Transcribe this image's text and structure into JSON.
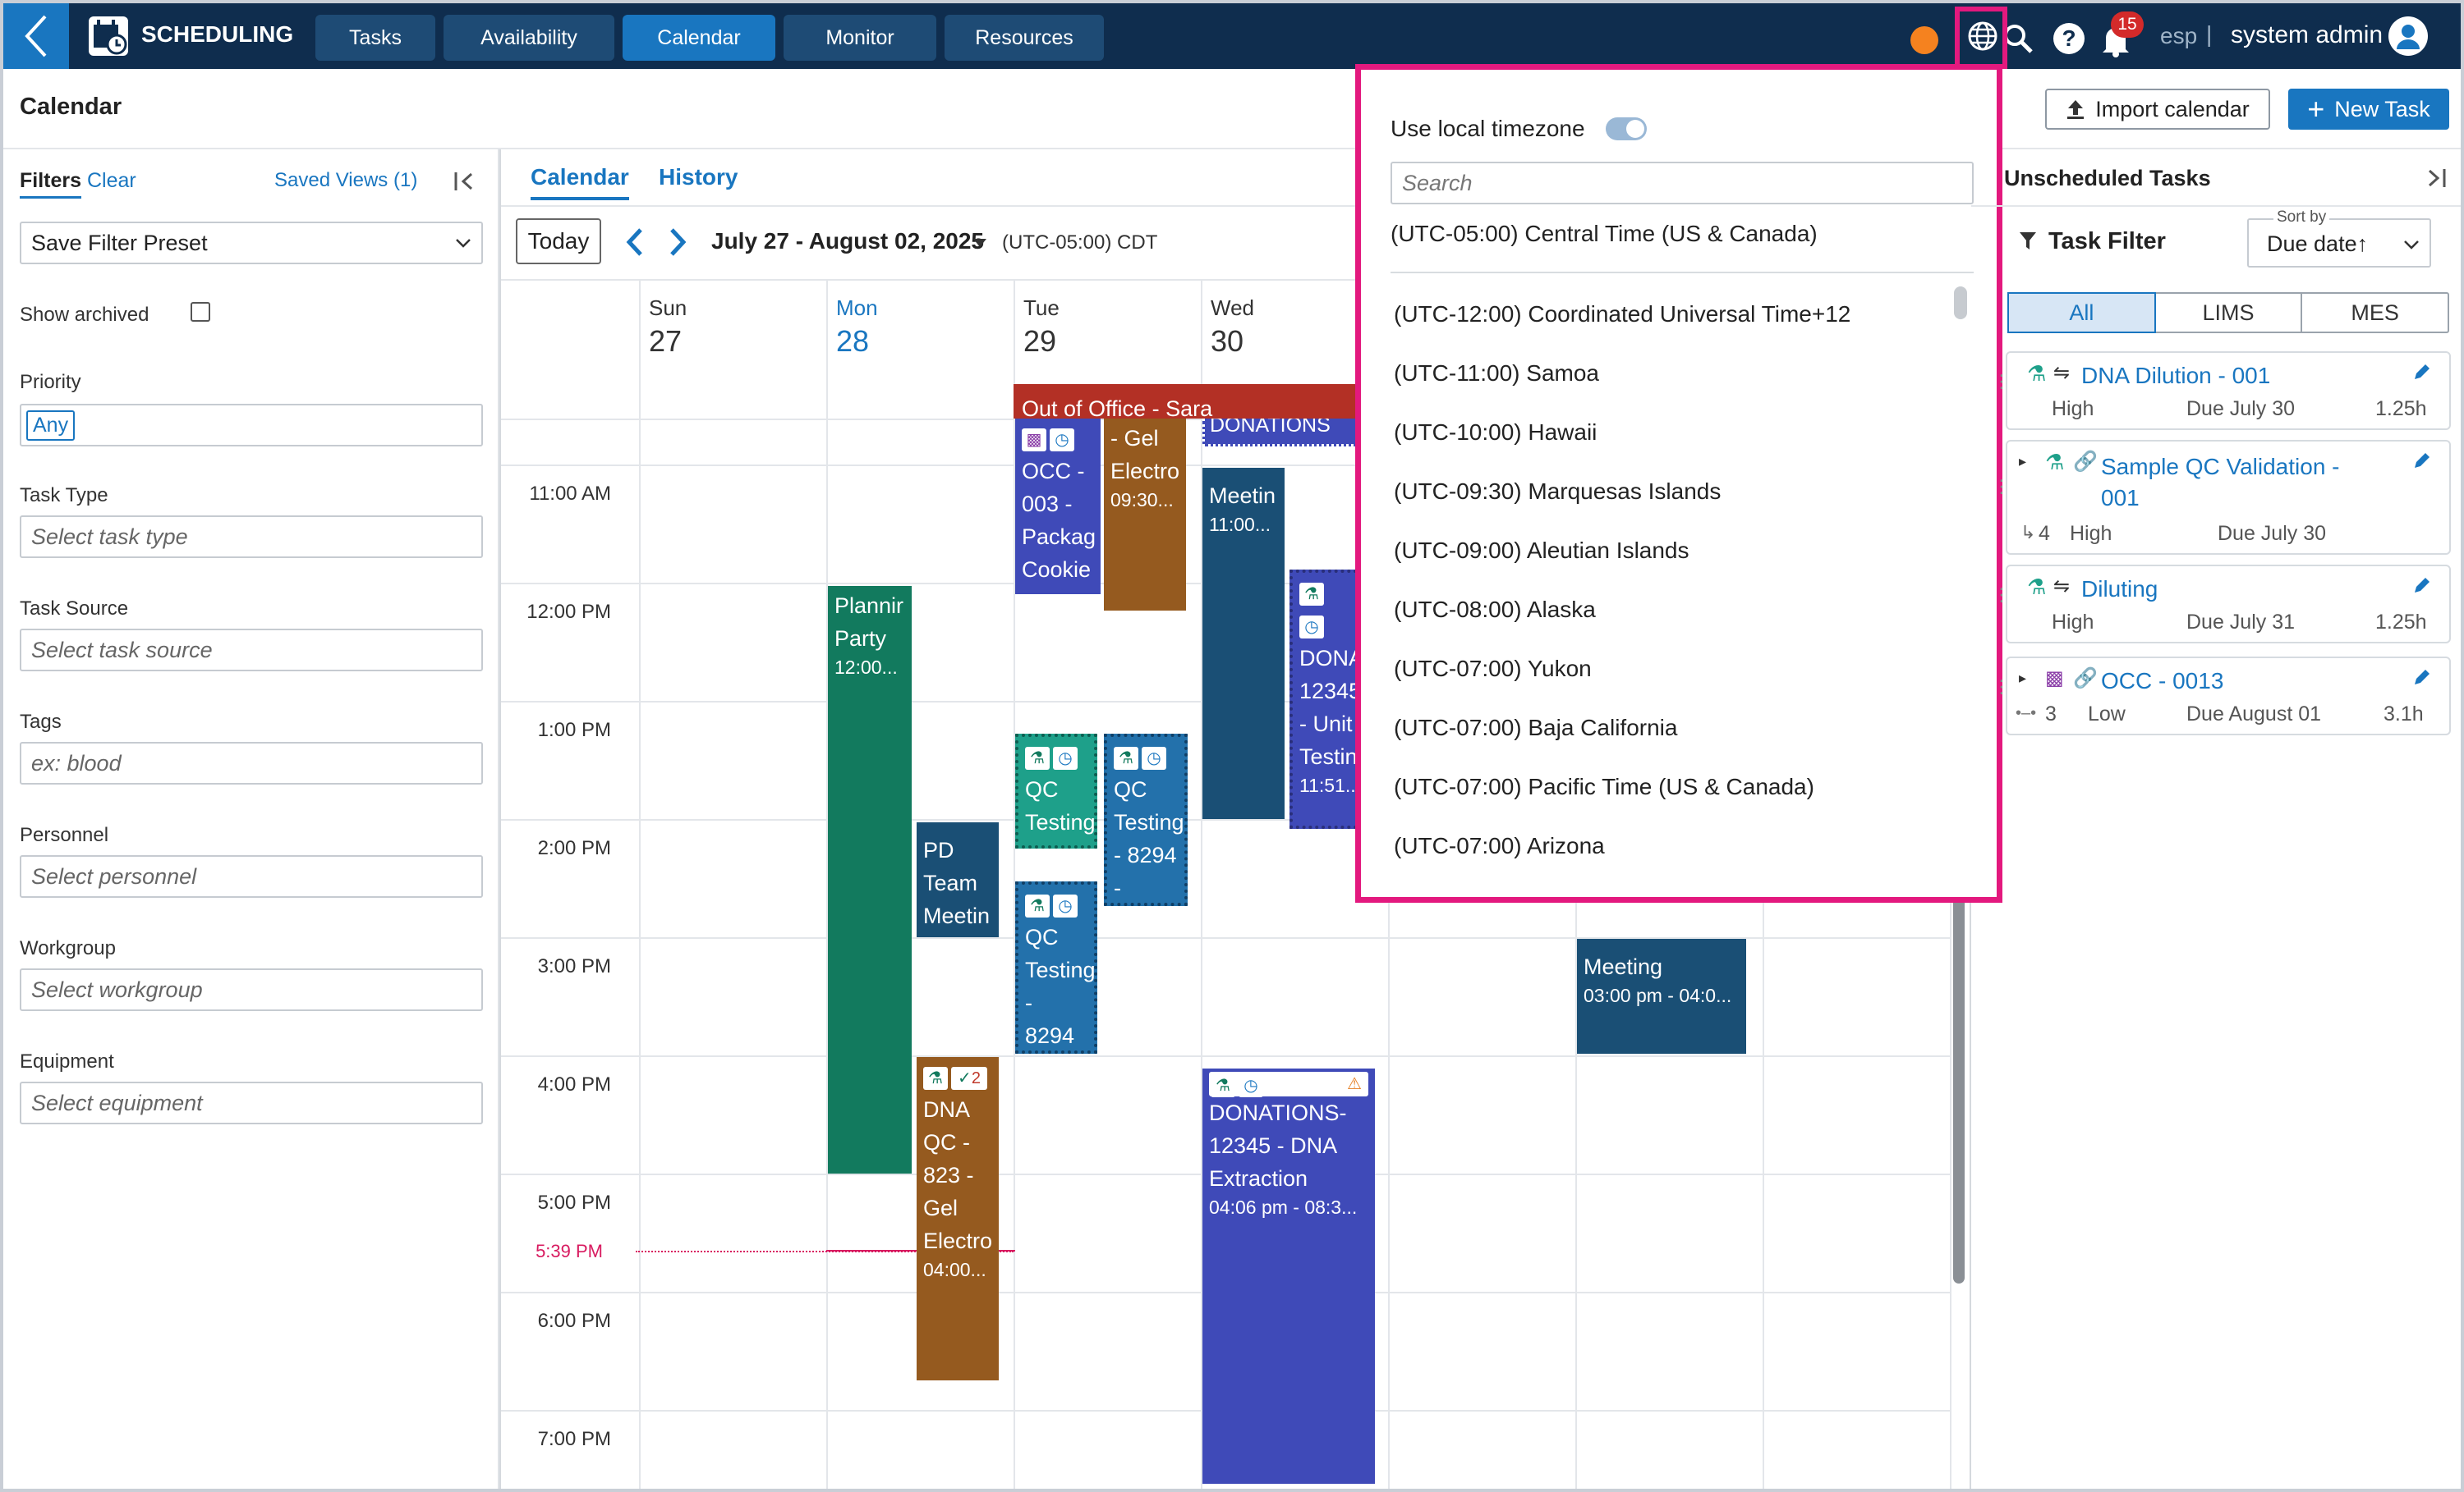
{
  "app": {
    "title": "SCHEDULING",
    "back_icon": "chevron-left-icon",
    "logo_icon": "calendar-clock-icon"
  },
  "nav": {
    "tabs": [
      "Tasks",
      "Availability",
      "Calendar",
      "Monitor",
      "Resources"
    ],
    "active": "Calendar"
  },
  "header": {
    "notifications": "15",
    "lang": "esp",
    "separator": "|",
    "user": "system admin",
    "status_color": "#f5821f"
  },
  "page": {
    "title": "Calendar",
    "import": "Import calendar",
    "new_task": "New Task"
  },
  "filters": {
    "title": "Filters",
    "clear": "Clear",
    "saved_views": "Saved Views (1)",
    "preset": "Save Filter Preset",
    "show_archived": "Show archived",
    "priority_label": "Priority",
    "priority_value": "Any",
    "task_type_label": "Task Type",
    "task_type_ph": "Select task type",
    "task_source_label": "Task Source",
    "task_source_ph": "Select task source",
    "tags_label": "Tags",
    "tags_ph": "ex: blood",
    "personnel_label": "Personnel",
    "personnel_ph": "Select personnel",
    "workgroup_label": "Workgroup",
    "workgroup_ph": "Select workgroup",
    "equipment_label": "Equipment",
    "equipment_ph": "Select equipment"
  },
  "calendar": {
    "tabs": [
      "Calendar",
      "History"
    ],
    "today": "Today",
    "range": "July 27 - August 02, 2025",
    "tz": "(UTC-05:00) CDT",
    "days": [
      {
        "name": "Sun",
        "num": "27"
      },
      {
        "name": "Mon",
        "num": "28"
      },
      {
        "name": "Tue",
        "num": "29"
      },
      {
        "name": "Wed",
        "num": "30"
      }
    ],
    "times": [
      "11:00 AM",
      "12:00 PM",
      "1:00 PM",
      "2:00 PM",
      "3:00 PM",
      "4:00 PM",
      "5:00 PM",
      "6:00 PM",
      "7:00 PM"
    ],
    "now": "5:39 PM",
    "events": {
      "ooo": "Out of Office - Sara",
      "donations_top": "DONATIONS",
      "occ": {
        "title": "OCC - 003 - Packag Cookie"
      },
      "gel": {
        "title": "- Gel Electro",
        "time": "09:30..."
      },
      "meeting_wed": {
        "title": "Meetin",
        "time": "11:00..."
      },
      "dona": {
        "title": "DONA 12345 - Unit Testin",
        "time": "11:51..."
      },
      "planning": {
        "title": "Plannir Party",
        "time": "12:00..."
      },
      "pd": {
        "title": "PD Team Meetin"
      },
      "qc1": {
        "title": "QC Testing"
      },
      "qc2": {
        "title": "QC Testing - 8294 -"
      },
      "qc3": {
        "title": "QC Testing - 8294 -"
      },
      "meeting_fri": {
        "title": "Meeting",
        "time": "03:00 pm - 04:0..."
      },
      "dna_qc": {
        "title": "DNA QC - 823 - Gel Electro",
        "time": "04:00...",
        "badge": "2"
      },
      "donations_dna": {
        "title": "DONATIONS- 12345 - DNA Extraction",
        "time": "04:06 pm - 08:3..."
      }
    },
    "colors": {
      "green": "#127a5e",
      "navy": "#1a4f75",
      "brown": "#955a1f",
      "indigo": "#3f4ab8",
      "red": "#b33025",
      "teal": "#1ea08a",
      "blue": "#2371ab"
    }
  },
  "timezone_popup": {
    "toggle_label": "Use local timezone",
    "search_ph": "Search",
    "selected": "(UTC-05:00) Central Time (US & Canada)",
    "options": [
      "(UTC-12:00) Coordinated Universal Time+12",
      "(UTC-11:00) Samoa",
      "(UTC-10:00) Hawaii",
      "(UTC-09:30) Marquesas Islands",
      "(UTC-09:00) Aleutian Islands",
      "(UTC-08:00) Alaska",
      "(UTC-07:00) Yukon",
      "(UTC-07:00) Baja California",
      "(UTC-07:00) Pacific Time (US & Canada)",
      "(UTC-07:00) Arizona"
    ],
    "highlight_color": "#e3197e"
  },
  "unscheduled": {
    "title": "Unscheduled Tasks",
    "filter": "Task Filter",
    "sort_label": "Sort by",
    "sort_value": "Due date↑",
    "tabs": [
      "All",
      "LIMS",
      "MES"
    ],
    "tasks": [
      {
        "name": "DNA Dilution - 001",
        "priority": "High",
        "due": "Due July 30",
        "dur": "1.25h"
      },
      {
        "name": "Sample QC Validation - 001",
        "priority": "High",
        "due": "Due July 30",
        "count": "4"
      },
      {
        "name": "Diluting",
        "priority": "High",
        "due": "Due July 31",
        "dur": "1.25h"
      },
      {
        "name": "OCC - 0013",
        "priority": "Low",
        "due": "Due August 01",
        "dur": "3.1h",
        "count": "3"
      }
    ]
  }
}
